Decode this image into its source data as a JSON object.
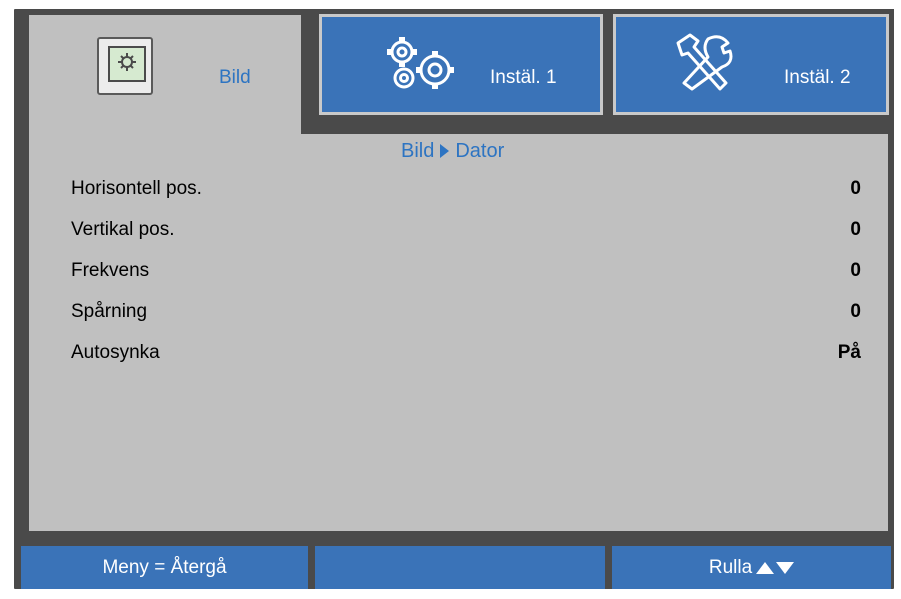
{
  "tabs": [
    {
      "label": "Bild",
      "icon": "picture-icon",
      "active": true
    },
    {
      "label": "Instäl. 1",
      "icon": "gears-icon",
      "active": false
    },
    {
      "label": "Instäl. 2",
      "icon": "tools-icon",
      "active": false
    }
  ],
  "breadcrumb": {
    "parent": "Bild",
    "current": "Dator"
  },
  "settings": [
    {
      "label": "Horisontell pos.",
      "value": "0"
    },
    {
      "label": "Vertikal pos.",
      "value": "0"
    },
    {
      "label": "Frekvens",
      "value": "0"
    },
    {
      "label": "Spårning",
      "value": "0"
    },
    {
      "label": "Autosynka",
      "value": "På"
    }
  ],
  "footer": {
    "menu_hint": "Meny = Återgå",
    "middle": "",
    "scroll_hint": "Rulla"
  },
  "colors": {
    "accent_blue": "#3a73b8",
    "label_blue": "#2d74c2",
    "panel_gray": "#c0c0c0",
    "frame_dark": "#4a4a4a"
  }
}
